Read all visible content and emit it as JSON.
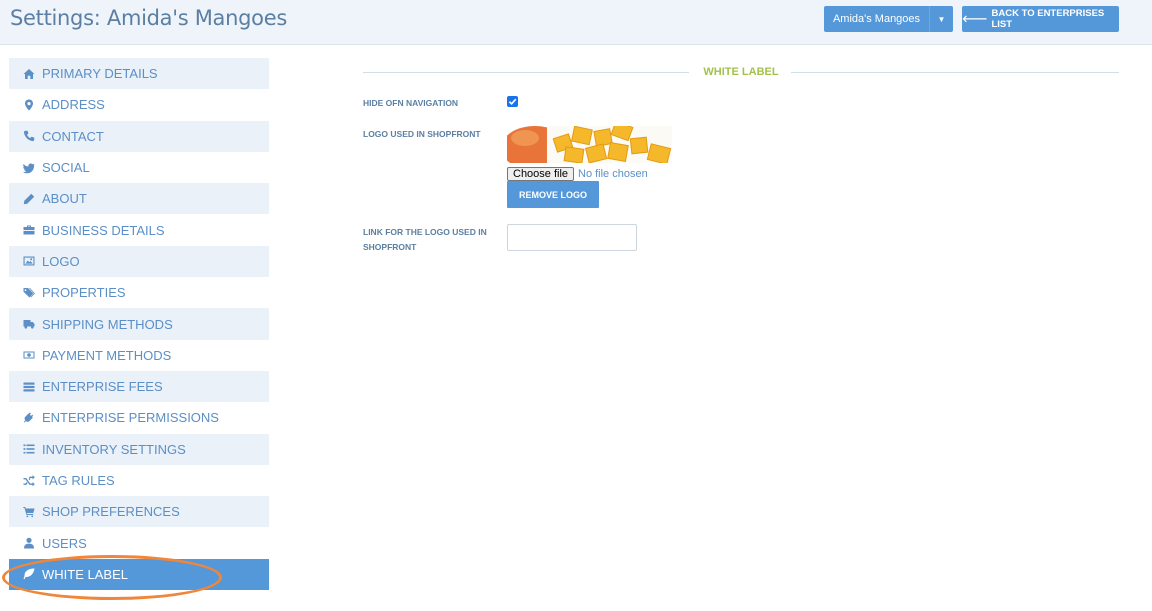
{
  "header": {
    "title": "Settings: Amida's Mangoes",
    "enterprise_select": "Amida's Mangoes",
    "back_button": "BACK TO ENTERPRISES LIST"
  },
  "sidebar": {
    "active_index": 15,
    "items": [
      {
        "label": "PRIMARY DETAILS",
        "icon": "home-icon"
      },
      {
        "label": "ADDRESS",
        "icon": "map-marker-icon"
      },
      {
        "label": "CONTACT",
        "icon": "phone-icon"
      },
      {
        "label": "SOCIAL",
        "icon": "twitter-icon"
      },
      {
        "label": "ABOUT",
        "icon": "pencil-icon"
      },
      {
        "label": "BUSINESS DETAILS",
        "icon": "briefcase-icon"
      },
      {
        "label": "LOGO",
        "icon": "image-icon"
      },
      {
        "label": "PROPERTIES",
        "icon": "tags-icon"
      },
      {
        "label": "SHIPPING METHODS",
        "icon": "truck-icon"
      },
      {
        "label": "PAYMENT METHODS",
        "icon": "money-icon"
      },
      {
        "label": "ENTERPRISE FEES",
        "icon": "fees-icon"
      },
      {
        "label": "ENTERPRISE PERMISSIONS",
        "icon": "plug-icon"
      },
      {
        "label": "INVENTORY SETTINGS",
        "icon": "list-icon"
      },
      {
        "label": "TAG RULES",
        "icon": "random-icon"
      },
      {
        "label": "SHOP PREFERENCES",
        "icon": "cart-icon"
      },
      {
        "label": "USERS",
        "icon": "user-icon"
      },
      {
        "label": "WHITE LABEL",
        "icon": "leaf-icon"
      }
    ]
  },
  "main": {
    "section_title": "WHITE LABEL",
    "hide_nav_label": "HIDE OFN NAVIGATION",
    "hide_nav_checked": true,
    "logo_label": "LOGO USED IN SHOPFRONT",
    "file_button": "Choose file",
    "file_status": "No file chosen",
    "remove_logo_button": "REMOVE LOGO",
    "logo_link_label": "LINK FOR THE LOGO USED IN SHOPFRONT",
    "logo_link_value": ""
  },
  "colors": {
    "accent": "#5498da",
    "section_title": "#a3c24a",
    "highlight_ellipse": "#f0863a"
  }
}
